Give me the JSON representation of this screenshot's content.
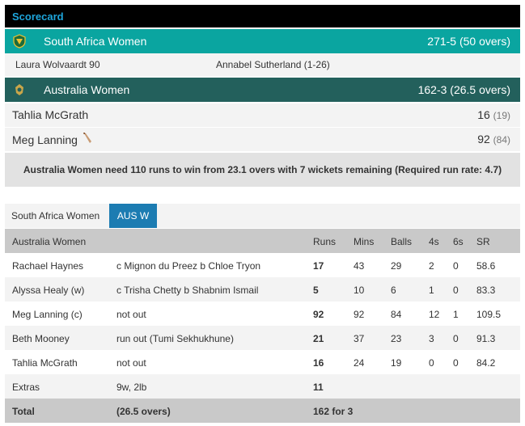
{
  "header": {
    "title": "Scorecard"
  },
  "innings1": {
    "team": "South Africa Women",
    "score": "271-5 (50 overs)",
    "flag_icon": "south-africa-flag-icon"
  },
  "performers": {
    "batter": "Laura Wolvaardt 90",
    "bowler": "Annabel Sutherland (1-26)"
  },
  "innings2": {
    "team": "Australia Women",
    "score": "162-3 (26.5 overs)",
    "flag_icon": "australia-flag-icon"
  },
  "current_batters": [
    {
      "name": "Tahlia McGrath",
      "runs": "16",
      "balls": "(19)"
    },
    {
      "name": "Meg Lanning",
      "runs": "92",
      "balls": "(84)",
      "on_strike": true
    }
  ],
  "status": "Australia Women need 110 runs to win from 23.1 overs with 7 wickets remaining (Required run rate: 4.7)",
  "tabs": [
    {
      "label": "South Africa Women",
      "active": false
    },
    {
      "label": "AUS W",
      "active": true
    }
  ],
  "batting_table": {
    "headers": {
      "team": "Australia Women",
      "runs": "Runs",
      "mins": "Mins",
      "balls": "Balls",
      "fours": "4s",
      "sixes": "6s",
      "sr": "SR"
    },
    "rows": [
      {
        "name": "Rachael Haynes",
        "dismissal": "c Mignon du Preez b Chloe Tryon",
        "runs": "17",
        "mins": "43",
        "balls": "29",
        "fours": "2",
        "sixes": "0",
        "sr": "58.6"
      },
      {
        "name": "Alyssa Healy (w)",
        "dismissal": "c Trisha Chetty b Shabnim Ismail",
        "runs": "5",
        "mins": "10",
        "balls": "6",
        "fours": "1",
        "sixes": "0",
        "sr": "83.3"
      },
      {
        "name": "Meg Lanning (c)",
        "dismissal": "not out",
        "runs": "92",
        "mins": "92",
        "balls": "84",
        "fours": "12",
        "sixes": "1",
        "sr": "109.5"
      },
      {
        "name": "Beth Mooney",
        "dismissal": "run out (Tumi Sekhukhune)",
        "runs": "21",
        "mins": "37",
        "balls": "23",
        "fours": "3",
        "sixes": "0",
        "sr": "91.3"
      },
      {
        "name": "Tahlia McGrath",
        "dismissal": "not out",
        "runs": "16",
        "mins": "24",
        "balls": "19",
        "fours": "0",
        "sixes": "0",
        "sr": "84.2"
      }
    ],
    "extras": {
      "label": "Extras",
      "detail": "9w, 2lb",
      "runs": "11"
    },
    "total": {
      "label": "Total",
      "overs": "(26.5 overs)",
      "score": "162 for 3"
    }
  },
  "colors": {
    "sa_bar": "#0aa5a0",
    "aus_bar": "#23605c",
    "active_tab": "#1c7cb2",
    "title": "#1ea6dc"
  }
}
